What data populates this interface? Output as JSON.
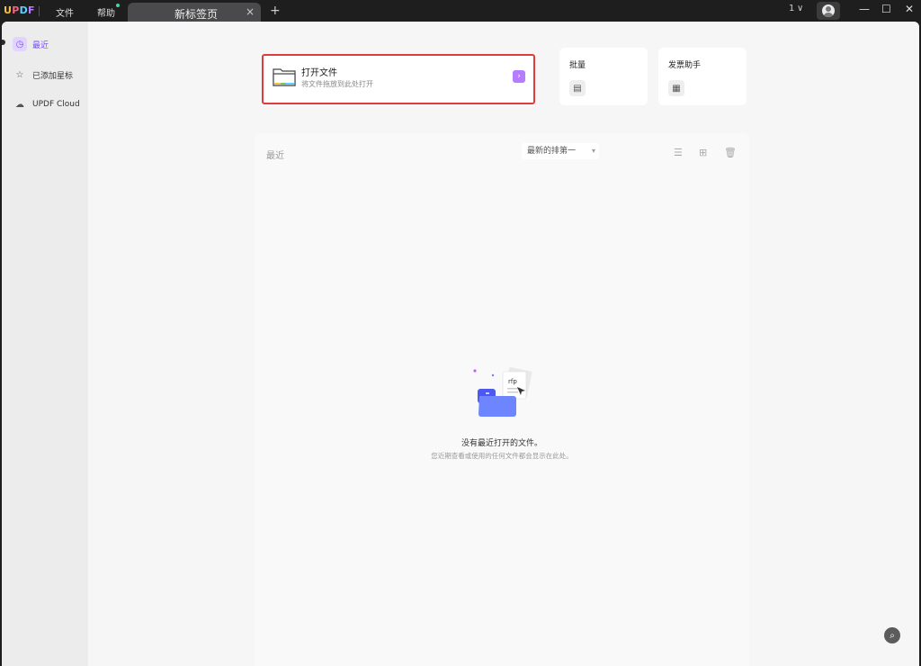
{
  "titlebar": {
    "logo": "UPDF",
    "menu_file": "文件",
    "menu_help": "帮助",
    "tab_title": "新标签页",
    "tab_close": "×",
    "tab_add": "+",
    "account_count": "1",
    "account_caret": "∨",
    "win_minimize": "—",
    "win_maximize": "☐",
    "win_close": "✕"
  },
  "sidebar": {
    "items": [
      {
        "label": "最近",
        "icon": "clock-icon",
        "active": true
      },
      {
        "label": "已添加星标",
        "icon": "star-icon",
        "active": false
      },
      {
        "label": "UPDF Cloud",
        "icon": "cloud-icon",
        "active": false
      }
    ]
  },
  "main": {
    "open_file": {
      "title": "打开文件",
      "subtitle": "将文件拖放到此处打开",
      "arrow": "›"
    },
    "batch": {
      "title": "批量"
    },
    "invoice": {
      "title": "发票助手"
    },
    "recent": {
      "label": "最近",
      "sort_value": "最新的排第一",
      "sort_caret": "▾",
      "empty_title": "没有最近打开的文件。",
      "empty_subtitle": "您近期查看或使用的任何文件都会显示在此处。"
    }
  },
  "colors": {
    "accent": "#b67cff",
    "highlight_border": "#e33b3b",
    "titlebar": "#1e1e1f"
  }
}
